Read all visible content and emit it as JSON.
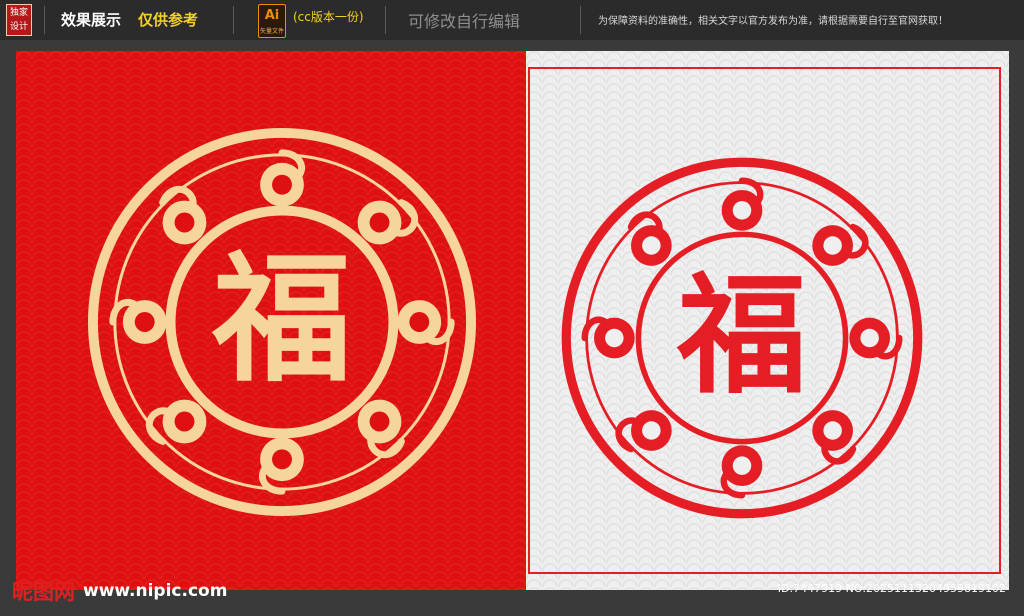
{
  "header": {
    "logo_text_1": "独家",
    "logo_text_2": "设计",
    "title": "效果展示",
    "subtitle": "仅供参考",
    "ai_icon": {
      "name": "adobe-illustrator-icon",
      "letter": "Ai",
      "sub": "矢量文件"
    },
    "version": "(cc版本一份)",
    "editable": "可修改自行编辑",
    "notice": "为保障资料的准确性，相关文字以官方发布为准，请根据需要自行至官网获取！"
  },
  "artwork": {
    "character": "福",
    "left_panel": {
      "background": "#df1010",
      "motif": "#f6d59a"
    },
    "right_panel": {
      "background": "#efefef",
      "motif": "#e51e26"
    }
  },
  "footer": {
    "brand": "昵图网",
    "url": "www.nipic.com",
    "id_text": "ID:7447919 NO:20251113204959819102"
  }
}
